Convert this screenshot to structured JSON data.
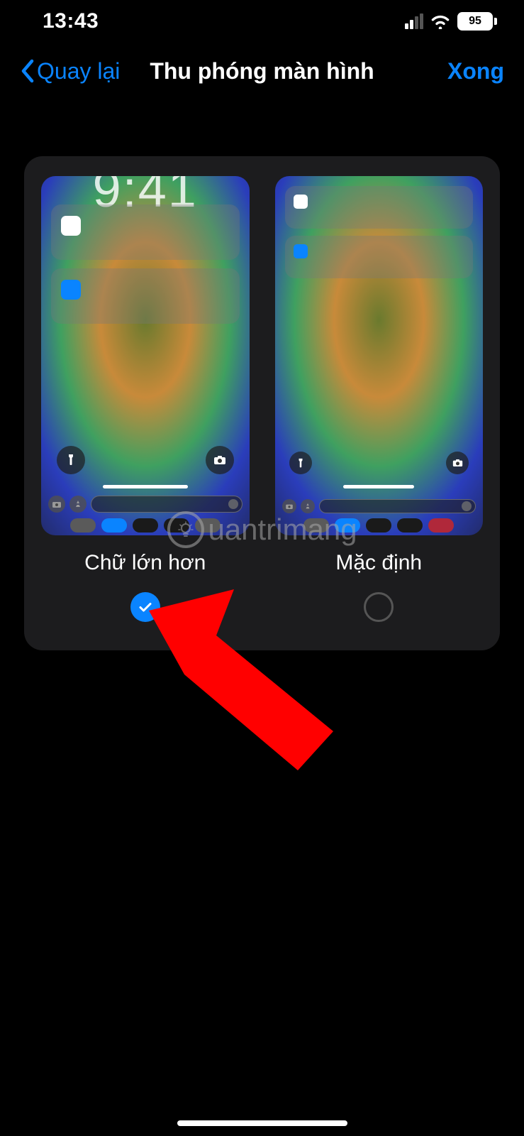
{
  "status": {
    "time": "13:43",
    "battery_pct": "95"
  },
  "nav": {
    "back_label": "Quay lại",
    "title": "Thu phóng màn hình",
    "done_label": "Xong"
  },
  "options": {
    "larger_text": {
      "label": "Chữ lớn hơn",
      "selected": true
    },
    "default": {
      "label": "Mặc định",
      "selected": false
    }
  },
  "watermark": {
    "text": "uantrimang"
  }
}
